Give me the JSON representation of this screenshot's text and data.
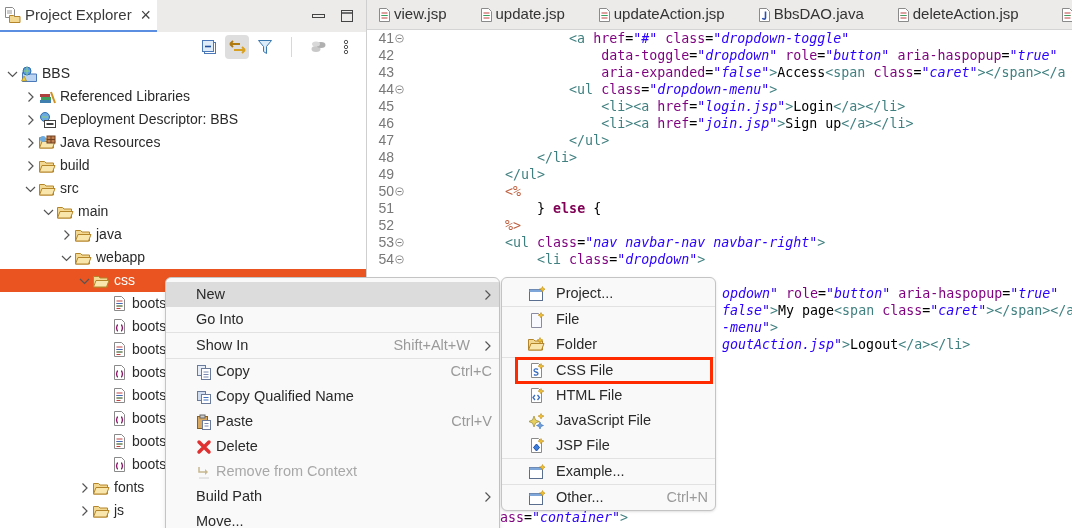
{
  "explorer": {
    "tab": {
      "label": "Project Explorer",
      "close": "×"
    },
    "toolbar": [
      {
        "kind": "collapse",
        "pressed": false
      },
      {
        "kind": "link",
        "pressed": true
      },
      {
        "kind": "filter",
        "pressed": false
      },
      {
        "kind": "separator"
      },
      {
        "kind": "sync",
        "pressed": false
      },
      {
        "kind": "more",
        "pressed": false
      }
    ],
    "tree": [
      {
        "label": "BBS",
        "kind": "project",
        "selected": false,
        "expanded": true,
        "children": [
          {
            "label": "Referenced Libraries",
            "kind": "libraries",
            "selected": false,
            "expanded": false
          },
          {
            "label": "Deployment Descriptor: BBS",
            "kind": "descriptor",
            "selected": false,
            "expanded": false
          },
          {
            "label": "Java Resources",
            "kind": "resources",
            "selected": false,
            "expanded": false
          },
          {
            "label": "build",
            "kind": "folder",
            "selected": false,
            "expanded": false
          },
          {
            "label": "src",
            "kind": "folder",
            "selected": false,
            "expanded": true,
            "children": [
              {
                "label": "main",
                "kind": "folder",
                "selected": false,
                "expanded": true,
                "children": [
                  {
                    "label": "java",
                    "kind": "folder",
                    "selected": false,
                    "expanded": false
                  },
                  {
                    "label": "webapp",
                    "kind": "folder",
                    "selected": false,
                    "expanded": true,
                    "children": [
                      {
                        "label": "css",
                        "kind": "folder",
                        "selected": true,
                        "expanded": true,
                        "children": [
                          {
                            "label": "boots",
                            "kind": "page",
                            "selected": false
                          },
                          {
                            "label": "boots",
                            "kind": "script",
                            "selected": false
                          },
                          {
                            "label": "boots",
                            "kind": "page",
                            "selected": false
                          },
                          {
                            "label": "boots",
                            "kind": "script",
                            "selected": false
                          },
                          {
                            "label": "boots",
                            "kind": "page",
                            "selected": false
                          },
                          {
                            "label": "boots",
                            "kind": "script",
                            "selected": false
                          },
                          {
                            "label": "boots",
                            "kind": "page",
                            "selected": false
                          },
                          {
                            "label": "boots",
                            "kind": "script",
                            "selected": false
                          }
                        ]
                      },
                      {
                        "label": "fonts",
                        "kind": "folder",
                        "selected": false,
                        "expanded": false
                      },
                      {
                        "label": "js",
                        "kind": "folder",
                        "selected": false,
                        "expanded": false
                      }
                    ]
                  }
                ]
              }
            ]
          }
        ]
      }
    ]
  },
  "editor": {
    "tabs": [
      {
        "label": "view.jsp",
        "kind": "jsp"
      },
      {
        "label": "update.jsp",
        "kind": "jsp"
      },
      {
        "label": "updateAction.jsp",
        "kind": "jsp"
      },
      {
        "label": "BbsDAO.java",
        "kind": "java"
      },
      {
        "label": "deleteAction.jsp",
        "kind": "jsp"
      },
      {
        "kind": "jsp"
      }
    ],
    "lines": [
      {
        "number": "41",
        "foldable": true,
        "tokens": [
          {
            "kind": "tag",
            "text": "                    <a "
          },
          {
            "kind": "attr",
            "text": "href"
          },
          {
            "kind": "plain",
            "text": "="
          },
          {
            "kind": "value",
            "text": "\"#\" "
          },
          {
            "kind": "attr",
            "text": "class"
          },
          {
            "kind": "plain",
            "text": "="
          },
          {
            "kind": "value",
            "text": "\"dropdown-toggle\""
          }
        ]
      },
      {
        "number": "42",
        "foldable": false,
        "tokens": [
          {
            "kind": "attr",
            "text": "                        data-toggle"
          },
          {
            "kind": "plain",
            "text": "="
          },
          {
            "kind": "value",
            "text": "\"dropdown\" "
          },
          {
            "kind": "attr",
            "text": "role"
          },
          {
            "kind": "plain",
            "text": "="
          },
          {
            "kind": "value",
            "text": "\"button\" "
          },
          {
            "kind": "attr",
            "text": "aria-haspopup"
          },
          {
            "kind": "plain",
            "text": "="
          },
          {
            "kind": "value",
            "text": "\"true\""
          }
        ]
      },
      {
        "number": "43",
        "foldable": false,
        "tokens": [
          {
            "kind": "attr",
            "text": "                        aria-expanded"
          },
          {
            "kind": "plain",
            "text": "="
          },
          {
            "kind": "value",
            "text": "\"false\""
          },
          {
            "kind": "tag",
            "text": ">"
          },
          {
            "kind": "plain",
            "text": "Access"
          },
          {
            "kind": "tag",
            "text": "<span "
          },
          {
            "kind": "attr",
            "text": "class"
          },
          {
            "kind": "plain",
            "text": "="
          },
          {
            "kind": "value",
            "text": "\"caret\""
          },
          {
            "kind": "tag",
            "text": "></span></a"
          }
        ]
      },
      {
        "number": "44",
        "foldable": true,
        "tokens": [
          {
            "kind": "tag",
            "text": "                    <ul "
          },
          {
            "kind": "attr",
            "text": "class"
          },
          {
            "kind": "plain",
            "text": "="
          },
          {
            "kind": "value",
            "text": "\"dropdown-menu\""
          },
          {
            "kind": "tag",
            "text": ">"
          }
        ]
      },
      {
        "number": "45",
        "foldable": false,
        "tokens": [
          {
            "kind": "tag",
            "text": "                        <li><a "
          },
          {
            "kind": "attr",
            "text": "href"
          },
          {
            "kind": "plain",
            "text": "="
          },
          {
            "kind": "value",
            "text": "\"login.jsp\""
          },
          {
            "kind": "tag",
            "text": ">"
          },
          {
            "kind": "plain",
            "text": "Login"
          },
          {
            "kind": "tag",
            "text": "</a></li>"
          }
        ]
      },
      {
        "number": "46",
        "foldable": false,
        "tokens": [
          {
            "kind": "tag",
            "text": "                        <li><a "
          },
          {
            "kind": "attr",
            "text": "href"
          },
          {
            "kind": "plain",
            "text": "="
          },
          {
            "kind": "value",
            "text": "\"join.jsp\""
          },
          {
            "kind": "tag",
            "text": ">"
          },
          {
            "kind": "plain",
            "text": "Sign up"
          },
          {
            "kind": "tag",
            "text": "</a></li>"
          }
        ]
      },
      {
        "number": "47",
        "foldable": false,
        "tokens": [
          {
            "kind": "tag",
            "text": "                    </ul>"
          }
        ]
      },
      {
        "number": "48",
        "foldable": false,
        "tokens": [
          {
            "kind": "tag",
            "text": "                </li>"
          }
        ]
      },
      {
        "number": "49",
        "foldable": false,
        "tokens": [
          {
            "kind": "tag",
            "text": "            </ul>"
          }
        ]
      },
      {
        "number": "50",
        "foldable": true,
        "tokens": [
          {
            "kind": "jsp",
            "text": "            <%"
          }
        ]
      },
      {
        "number": "51",
        "foldable": false,
        "tokens": [
          {
            "kind": "plain",
            "text": "                } "
          },
          {
            "kind": "keyword",
            "text": "else"
          },
          {
            "kind": "plain",
            "text": " {"
          }
        ]
      },
      {
        "number": "52",
        "foldable": false,
        "tokens": [
          {
            "kind": "jsp",
            "text": "            %>"
          }
        ]
      },
      {
        "number": "53",
        "foldable": true,
        "tokens": [
          {
            "kind": "tag",
            "text": "            <ul "
          },
          {
            "kind": "attr",
            "text": "class"
          },
          {
            "kind": "plain",
            "text": "="
          },
          {
            "kind": "value",
            "text": "\"nav navbar-nav navbar-right\""
          },
          {
            "kind": "tag",
            "text": ">"
          }
        ]
      },
      {
        "number": "54",
        "foldable": true,
        "tokens": [
          {
            "kind": "tag",
            "text": "                <li "
          },
          {
            "kind": "attr",
            "text": "class"
          },
          {
            "kind": "plain",
            "text": "="
          },
          {
            "kind": "value",
            "text": "\"dropdown\""
          },
          {
            "kind": "tag",
            "text": ">"
          }
        ]
      }
    ],
    "partly_hidden": [
      [
        {
          "tokens": [
            {
              "kind": "value",
              "text": "opdown\" "
            },
            {
              "kind": "attr",
              "text": "role"
            },
            {
              "kind": "plain",
              "text": "="
            },
            {
              "kind": "value",
              "text": "\"button\" "
            },
            {
              "kind": "attr",
              "text": "aria-haspopup"
            },
            {
              "kind": "plain",
              "text": "="
            },
            {
              "kind": "value",
              "text": "\"true\""
            }
          ]
        },
        {
          "tokens": [
            {
              "kind": "value",
              "text": "false\""
            },
            {
              "kind": "tag",
              "text": ">"
            },
            {
              "kind": "plain",
              "text": "My page"
            },
            {
              "kind": "tag",
              "text": "<span "
            },
            {
              "kind": "attr",
              "text": "class"
            },
            {
              "kind": "plain",
              "text": "="
            },
            {
              "kind": "value",
              "text": "\"caret\""
            },
            {
              "kind": "tag",
              "text": "></span></a"
            }
          ]
        },
        {
          "tokens": [
            {
              "kind": "value",
              "text": "-menu\""
            },
            {
              "kind": "tag",
              "text": ">"
            }
          ]
        },
        {
          "tokens": [
            {
              "kind": "value",
              "text": "goutAction.jsp\""
            },
            {
              "kind": "tag",
              "text": ">"
            },
            {
              "kind": "plain",
              "text": "Logout"
            },
            {
              "kind": "tag",
              "text": "</a></li>"
            }
          ]
        }
      ],
      [
        {
          "tokens": [
            {
              "kind": "attr",
              "text": "ass"
            },
            {
              "kind": "plain",
              "text": "="
            },
            {
              "kind": "value",
              "text": "\"container\""
            },
            {
              "kind": "tag",
              "text": ">"
            }
          ]
        }
      ]
    ]
  },
  "context_menu": [
    {
      "kind": "plain",
      "label": "New",
      "submenu": true,
      "selected": true,
      "disabled": false
    },
    {
      "kind": "plain",
      "label": "Go Into",
      "submenu": false,
      "selected": false,
      "disabled": false
    },
    {
      "kind": "separator"
    },
    {
      "kind": "plain",
      "label": "Show In",
      "shortcut": "Shift+Alt+W",
      "submenu": true,
      "selected": false,
      "disabled": false
    },
    {
      "kind": "separator"
    },
    {
      "kind": "copy",
      "label": "Copy",
      "shortcut": "Ctrl+C",
      "submenu": false,
      "selected": false,
      "disabled": false
    },
    {
      "kind": "qualified",
      "label": "Copy Qualified Name",
      "submenu": false,
      "selected": false,
      "disabled": false
    },
    {
      "kind": "paste",
      "label": "Paste",
      "shortcut": "Ctrl+V",
      "submenu": false,
      "selected": false,
      "disabled": false
    },
    {
      "kind": "delete",
      "label": "Delete",
      "submenu": false,
      "selected": false,
      "disabled": false
    },
    {
      "kind": "remove",
      "label": "Remove from Context",
      "submenu": false,
      "selected": false,
      "disabled": true
    },
    {
      "kind": "plain",
      "label": "Build Path",
      "submenu": true,
      "selected": false,
      "disabled": false
    },
    {
      "kind": "plain",
      "label": "Move...",
      "submenu": false,
      "selected": false,
      "disabled": false
    }
  ],
  "new_submenu": [
    {
      "kind": "wizard",
      "label": "Project...",
      "boxed": false
    },
    {
      "kind": "separator"
    },
    {
      "kind": "file",
      "label": "File",
      "boxed": false
    },
    {
      "kind": "folder",
      "label": "Folder",
      "boxed": false
    },
    {
      "kind": "separator"
    },
    {
      "kind": "css",
      "label": "CSS File",
      "boxed": true
    },
    {
      "kind": "html",
      "label": "HTML File",
      "boxed": false
    },
    {
      "kind": "javascript",
      "label": "JavaScript File",
      "boxed": false
    },
    {
      "kind": "jsp",
      "label": "JSP File",
      "boxed": false
    },
    {
      "kind": "separator"
    },
    {
      "kind": "wizard",
      "label": "Example...",
      "boxed": false
    },
    {
      "kind": "separator"
    },
    {
      "kind": "wizard",
      "label": "Other...",
      "shortcut": "Ctrl+N",
      "boxed": false
    }
  ]
}
